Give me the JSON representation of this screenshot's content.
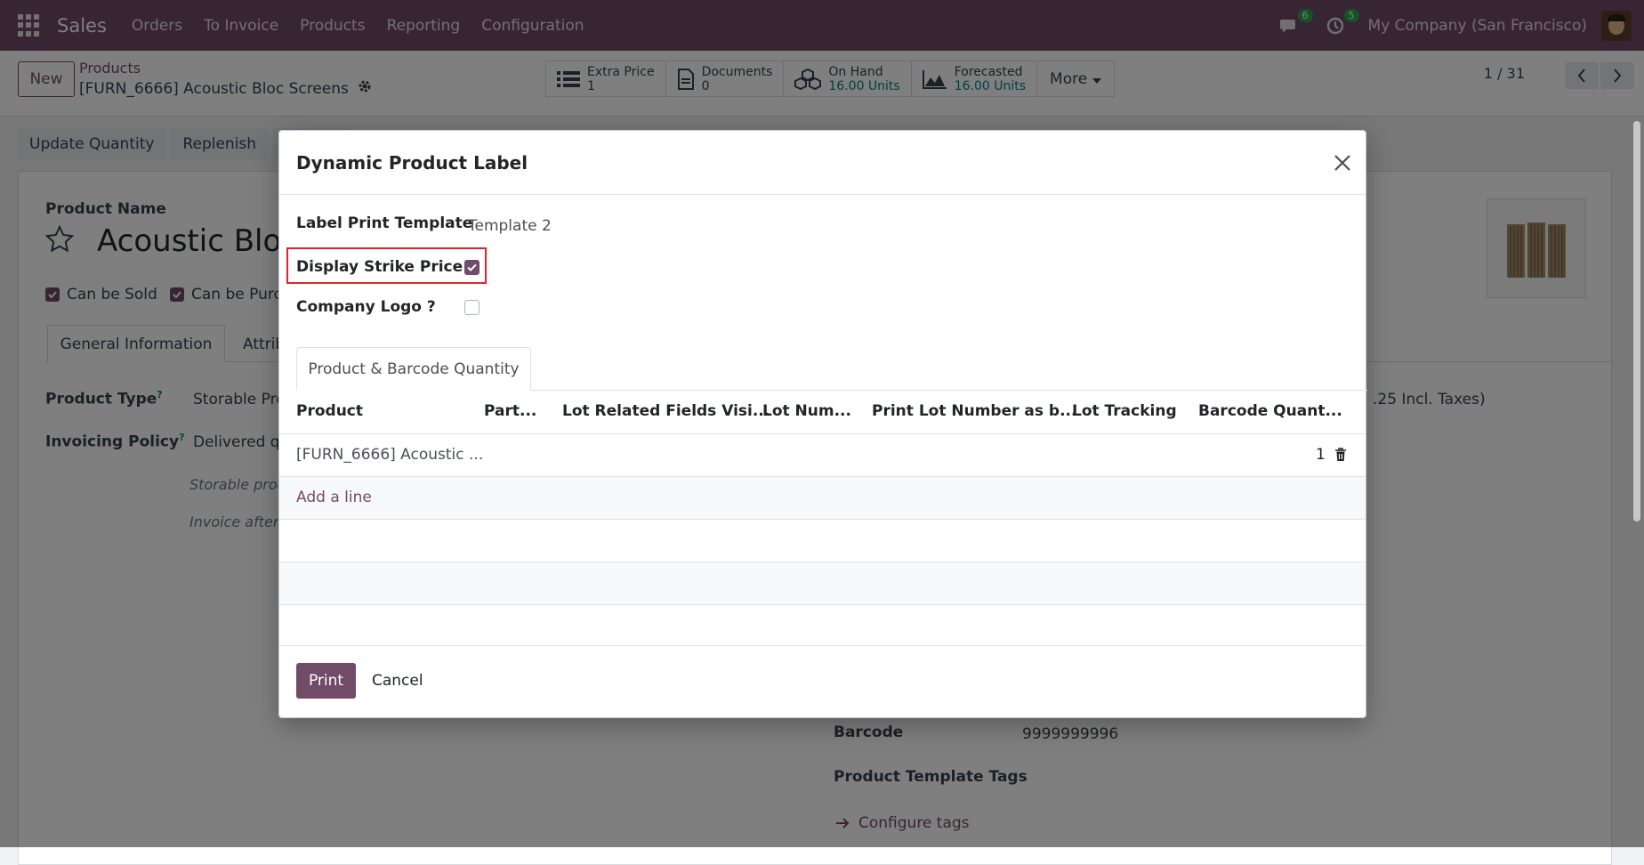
{
  "nav": {
    "brand": "Sales",
    "menu": [
      "Orders",
      "To Invoice",
      "Products",
      "Reporting",
      "Configuration"
    ],
    "messages_count": "6",
    "activities_count": "5",
    "company": "My Company (San Francisco)"
  },
  "control": {
    "new_label": "New",
    "breadcrumb_parent": "Products",
    "breadcrumb_current": "[FURN_6666] Acoustic Bloc Screens",
    "smart_buttons": [
      {
        "label": "Extra Price",
        "value": "1"
      },
      {
        "label": "Documents",
        "value": "0"
      },
      {
        "label": "On Hand",
        "value": "16.00 Units"
      },
      {
        "label": "Forecasted",
        "value": "16.00 Units"
      }
    ],
    "more_label": "More",
    "pager": "1 / 31"
  },
  "form": {
    "buttons": [
      "Update Quantity",
      "Replenish",
      ""
    ],
    "product_name_label": "Product Name",
    "product_name": "Acoustic Bloc",
    "can_be_sold": "Can be Sold",
    "can_be_purchased": "Can be Purc",
    "tab_general": "General Information",
    "tab_attributes": "Attrib",
    "product_type_label": "Product Type",
    "product_type_value": "Storable Pro",
    "invoicing_policy_label": "Invoicing Policy",
    "invoicing_policy_value": "Delivered qu",
    "help_1": "Storable prod",
    "help_2": "Invoice after",
    "price_fragment": ".25 Incl. Taxes)",
    "barcode_label": "Barcode",
    "barcode_value": "9999999996",
    "tags_label": "Product Template Tags",
    "configure_tags": "Configure tags"
  },
  "modal": {
    "title": "Dynamic Product Label",
    "template_label": "Label Print Template",
    "template_value": "Template 2",
    "strike_label": "Display Strike Price ?",
    "logo_label": "Company Logo ?",
    "tab_label": "Product & Barcode Quantity",
    "columns": [
      "Product",
      "Part...",
      "Lot Related Fields Visi...",
      "Lot Num...",
      "Print Lot Number as b...",
      "Lot Tracking",
      "Barcode Quant..."
    ],
    "row_product": "[FURN_6666] Acoustic ...",
    "row_quantity": "1",
    "add_line": "Add a line",
    "print_label": "Print",
    "cancel_label": "Cancel"
  },
  "colors": {
    "brand": "#714b67",
    "highlight": "#e0242c",
    "smart_value": "#017e84"
  }
}
